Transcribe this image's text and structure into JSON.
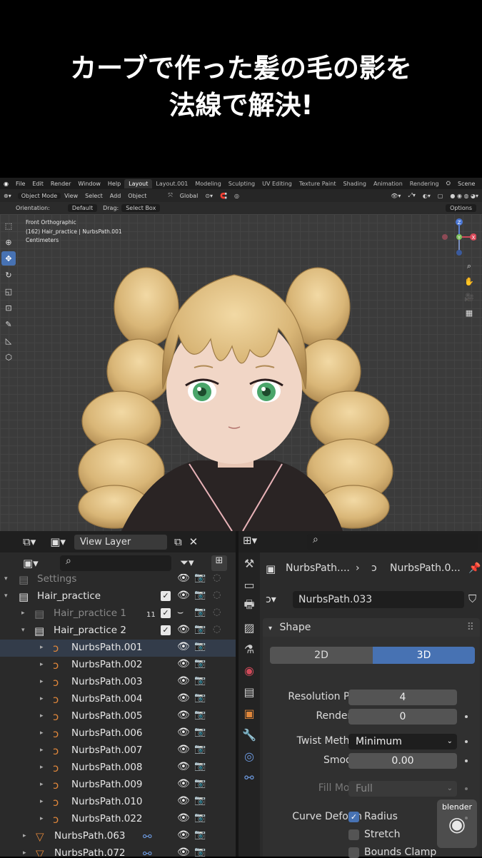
{
  "title": {
    "line1": "カーブで作った髪の毛の影を",
    "line2": "法線で解決!"
  },
  "menubar": {
    "items": [
      "File",
      "Edit",
      "Render",
      "Window",
      "Help"
    ],
    "workspaces": [
      "Layout",
      "Layout.001",
      "Modeling",
      "Sculpting",
      "UV Editing",
      "Texture Paint",
      "Shading",
      "Animation",
      "Rendering"
    ],
    "active_workspace": "Layout",
    "scene": "Scene"
  },
  "header": {
    "mode": "Object Mode",
    "menus": [
      "View",
      "Select",
      "Add",
      "Object"
    ],
    "transform": "Global",
    "orientation_label": "Orientation:",
    "orientation_value": "Default",
    "drag_label": "Drag:",
    "drag_value": "Select Box",
    "options": "Options"
  },
  "viewport": {
    "info_line1": "Front Orthographic",
    "info_line2": "(162) Hair_practice | NurbsPath.001",
    "info_line3": "Centimeters",
    "gizmo": {
      "z": "Z",
      "x": "X",
      "y": "Y"
    }
  },
  "outliner": {
    "view_layer": "View Layer",
    "rows": [
      {
        "label": "Settings",
        "icon": "collection-icon",
        "indent": 0,
        "faded": true
      },
      {
        "label": "Hair_practice",
        "icon": "collection-icon",
        "indent": 0,
        "checked": true
      },
      {
        "label": "Hair_practice 1",
        "icon": "collection-icon",
        "indent": 1,
        "faded": true,
        "badge": "11",
        "checked": true
      },
      {
        "label": "Hair_practice 2",
        "icon": "collection-icon",
        "indent": 1,
        "checked": true
      },
      {
        "label": "NurbsPath.001",
        "icon": "curve-icon",
        "indent": 2,
        "selected": true
      },
      {
        "label": "NurbsPath.002",
        "icon": "curve-icon",
        "indent": 2
      },
      {
        "label": "NurbsPath.003",
        "icon": "curve-icon",
        "indent": 2
      },
      {
        "label": "NurbsPath.004",
        "icon": "curve-icon",
        "indent": 2
      },
      {
        "label": "NurbsPath.005",
        "icon": "curve-icon",
        "indent": 2
      },
      {
        "label": "NurbsPath.006",
        "icon": "curve-icon",
        "indent": 2
      },
      {
        "label": "NurbsPath.007",
        "icon": "curve-icon",
        "indent": 2
      },
      {
        "label": "NurbsPath.008",
        "icon": "curve-icon",
        "indent": 2
      },
      {
        "label": "NurbsPath.009",
        "icon": "curve-icon",
        "indent": 2
      },
      {
        "label": "NurbsPath.010",
        "icon": "curve-icon",
        "indent": 2
      },
      {
        "label": "NurbsPath.022",
        "icon": "curve-icon",
        "indent": 2
      },
      {
        "label": "NurbsPath.063",
        "icon": "mesh-icon",
        "indent": 0
      },
      {
        "label": "NurbsPath.072",
        "icon": "mesh-icon",
        "indent": 0
      }
    ]
  },
  "properties": {
    "breadcrumb_object": "NurbsPath....",
    "breadcrumb_data": "NurbsPath.0...",
    "datablock": "NurbsPath.033",
    "panel": "Shape",
    "dim_2d": "2D",
    "dim_3d": "3D",
    "resolution_label": "Resolution Pr...",
    "resolution_value": "4",
    "render_u_label": "Render U",
    "render_u_value": "0",
    "twist_label": "Twist Method",
    "twist_value": "Minimum",
    "smooth_label": "Smooth",
    "smooth_value": "0.00",
    "fill_label": "Fill Mode",
    "fill_value": "Full",
    "curve_deform_label": "Curve Deform",
    "radius_label": "Radius",
    "stretch_label": "Stretch",
    "bounds_label": "Bounds Clamp"
  },
  "watermark": "blender"
}
